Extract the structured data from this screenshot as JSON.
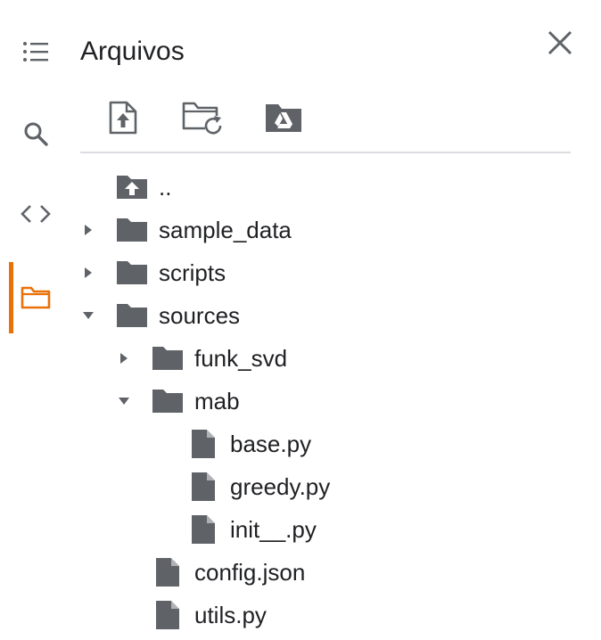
{
  "sidebar": {
    "items": [
      {
        "icon": "list-icon"
      },
      {
        "icon": "search-icon"
      },
      {
        "icon": "code-icon"
      },
      {
        "icon": "folder-icon",
        "active": true
      }
    ],
    "accent_color": "#e8710a"
  },
  "panel": {
    "title": "Arquivos",
    "close_icon": "close-icon",
    "toolbar": [
      {
        "icon": "upload-file-icon"
      },
      {
        "icon": "refresh-folder-icon"
      },
      {
        "icon": "mount-drive-icon"
      }
    ]
  },
  "tree": [
    {
      "label": "..",
      "type": "parent",
      "depth": 0
    },
    {
      "label": "sample_data",
      "type": "folder",
      "depth": 0,
      "state": "collapsed"
    },
    {
      "label": "scripts",
      "type": "folder",
      "depth": 0,
      "state": "collapsed"
    },
    {
      "label": "sources",
      "type": "folder",
      "depth": 0,
      "state": "expanded"
    },
    {
      "label": "funk_svd",
      "type": "folder",
      "depth": 1,
      "state": "collapsed"
    },
    {
      "label": "mab",
      "type": "folder",
      "depth": 1,
      "state": "expanded"
    },
    {
      "label": "base.py",
      "type": "file",
      "depth": 2
    },
    {
      "label": "greedy.py",
      "type": "file",
      "depth": 2
    },
    {
      "label": "init__.py",
      "type": "file",
      "depth": 2
    },
    {
      "label": "config.json",
      "type": "file",
      "depth": 1
    },
    {
      "label": "utils.py",
      "type": "file",
      "depth": 1
    }
  ],
  "colors": {
    "icon": "#5f6368",
    "divider": "#dadce0",
    "text": "#202124"
  }
}
